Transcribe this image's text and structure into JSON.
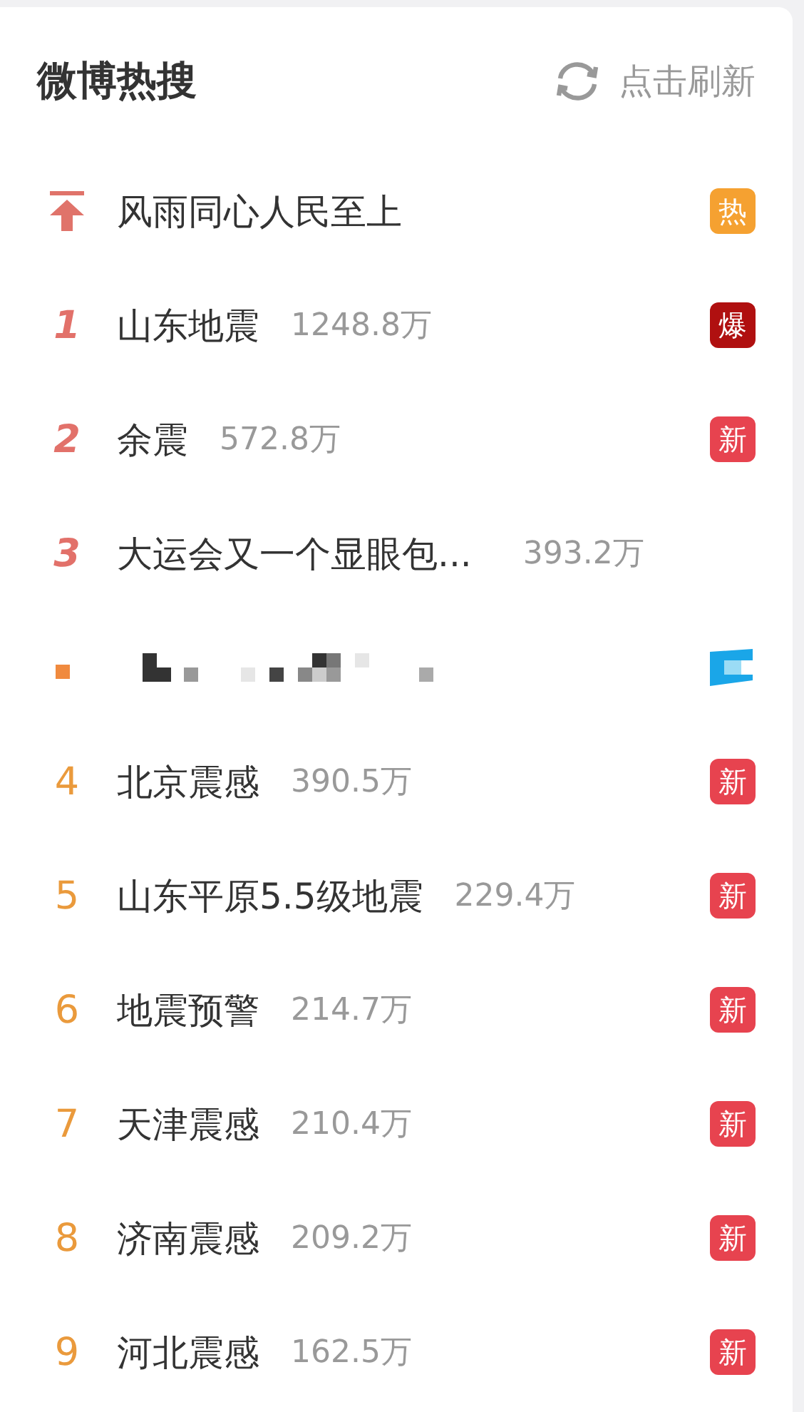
{
  "header": {
    "title": "微博热搜",
    "refresh": "点击刷新"
  },
  "items": [
    {
      "kind": "pinned",
      "title": "风雨同心人民至上",
      "badge": "热",
      "color": "#f5a131"
    },
    {
      "kind": "top",
      "rank": "1",
      "title": "山东地震",
      "count": "1248.8万",
      "badge": "爆",
      "color": "#b01010"
    },
    {
      "kind": "top",
      "rank": "2",
      "title": "余震",
      "count": "572.8万",
      "badge": "新",
      "color": "#e7434f"
    },
    {
      "kind": "top",
      "rank": "3",
      "title": "大运会又一个显眼包...",
      "count": "393.2万"
    },
    {
      "kind": "blurred"
    },
    {
      "kind": "ranked",
      "rank": "4",
      "title": "北京震感",
      "count": "390.5万",
      "badge": "新",
      "color": "#e7434f"
    },
    {
      "kind": "ranked",
      "rank": "5",
      "title": "山东平原5.5级地震",
      "count": "229.4万",
      "badge": "新",
      "color": "#e7434f"
    },
    {
      "kind": "ranked",
      "rank": "6",
      "title": "地震预警",
      "count": "214.7万",
      "badge": "新",
      "color": "#e7434f"
    },
    {
      "kind": "ranked",
      "rank": "7",
      "title": "天津震感",
      "count": "210.4万",
      "badge": "新",
      "color": "#e7434f"
    },
    {
      "kind": "ranked",
      "rank": "8",
      "title": "济南震感",
      "count": "209.2万",
      "badge": "新",
      "color": "#e7434f"
    },
    {
      "kind": "ranked",
      "rank": "9",
      "title": "河北震感",
      "count": "162.5万",
      "badge": "新",
      "color": "#e7434f"
    }
  ]
}
